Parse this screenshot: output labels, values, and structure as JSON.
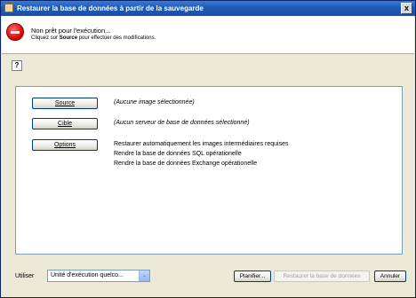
{
  "window": {
    "title": "Restaurer la base de données à partir de la sauvegarde",
    "close_glyph": "x"
  },
  "status": {
    "main": "Non prêt pour l'exécution...",
    "sub_before": "Cliquez sur ",
    "sub_bold": "Source",
    "sub_after": " pour effectuer des modifications."
  },
  "help": {
    "glyph": "?"
  },
  "rows": [
    {
      "button": "Source",
      "text": "(Aucune image sélectionnée)"
    },
    {
      "button": "Cible",
      "text": "(Aucun serveur de base de données sélectionné)"
    },
    {
      "button": "Options",
      "lines": [
        "Restaurer automatiquement les images intermédiaires requises",
        "Rendre la base de données SQL opérationelle",
        "Rendre la base de données Exchange opérationelle"
      ]
    }
  ],
  "footer": {
    "use_label": "Utiliser",
    "combo_value": "Unité d'exécution quelco...",
    "combo_arrow": "⌄",
    "schedule_label": "Planifier...",
    "restore_label": "Restaurer la base de données",
    "cancel_label": "Annuler"
  },
  "colors": {
    "titlebar": "#1d5ab8",
    "window_bg": "#ece9d8",
    "stop_icon": "#d40000"
  }
}
